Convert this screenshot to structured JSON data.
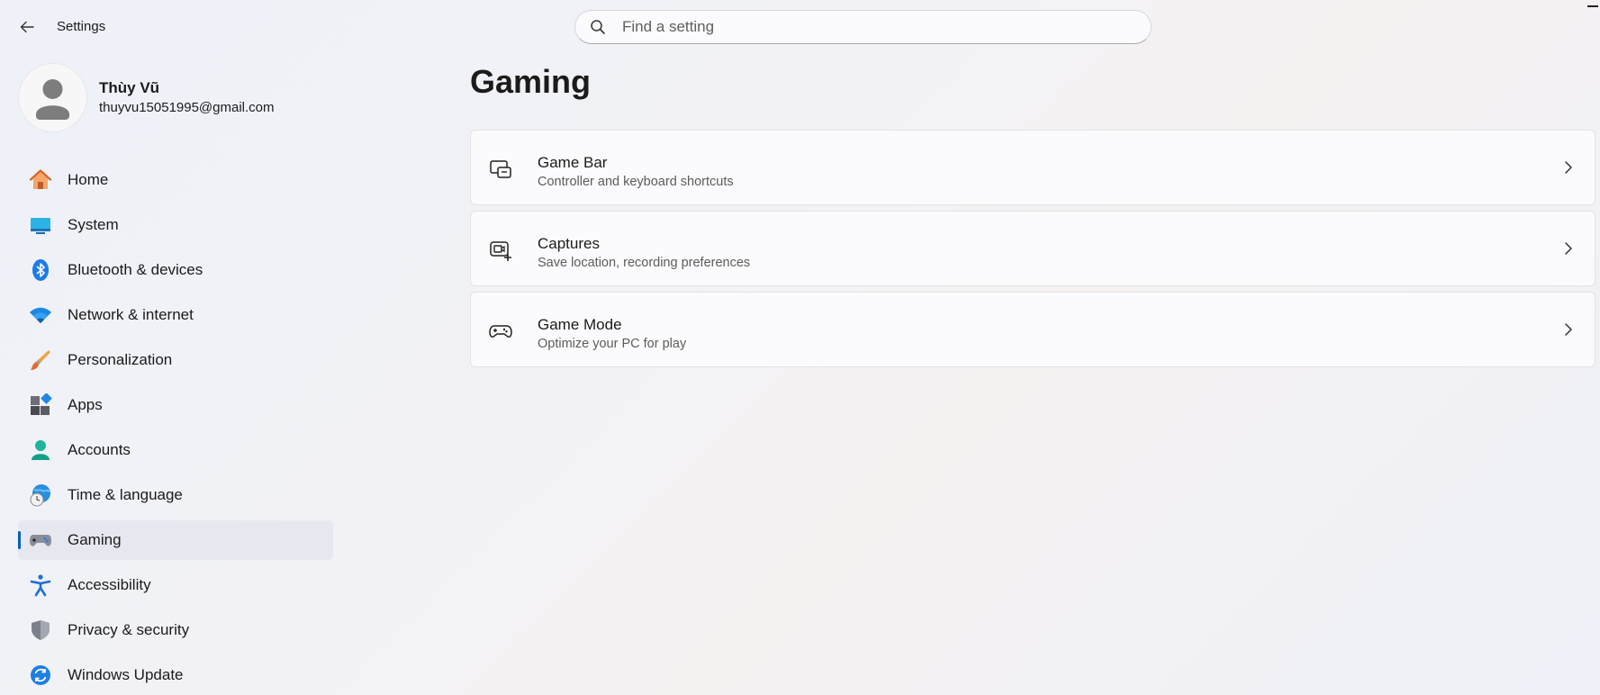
{
  "window": {
    "title": "Settings",
    "back_icon": "back-arrow-icon",
    "minimize_icon": "minimize-icon"
  },
  "search": {
    "placeholder": "Find a setting",
    "value": "",
    "icon": "search-icon"
  },
  "profile": {
    "name": "Thùy Vũ",
    "email": "thuyvu15051995@gmail.com",
    "avatar_icon": "user-avatar-icon"
  },
  "sidebar": {
    "active": "Gaming",
    "accent_color": "#005fb8",
    "items": [
      {
        "label": "Home",
        "icon": "home-icon"
      },
      {
        "label": "System",
        "icon": "monitor-icon"
      },
      {
        "label": "Bluetooth & devices",
        "icon": "bluetooth-icon"
      },
      {
        "label": "Network & internet",
        "icon": "wifi-icon"
      },
      {
        "label": "Personalization",
        "icon": "paintbrush-icon"
      },
      {
        "label": "Apps",
        "icon": "apps-icon"
      },
      {
        "label": "Accounts",
        "icon": "person-icon"
      },
      {
        "label": "Time & language",
        "icon": "globe-clock-icon"
      },
      {
        "label": "Gaming",
        "icon": "gamepad-icon"
      },
      {
        "label": "Accessibility",
        "icon": "accessibility-icon"
      },
      {
        "label": "Privacy & security",
        "icon": "shield-icon"
      },
      {
        "label": "Windows Update",
        "icon": "update-icon"
      }
    ]
  },
  "main": {
    "title": "Gaming",
    "cards": [
      {
        "title": "Game Bar",
        "subtitle": "Controller and keyboard shortcuts",
        "icon": "game-bar-icon"
      },
      {
        "title": "Captures",
        "subtitle": "Save location, recording preferences",
        "icon": "capture-icon"
      },
      {
        "title": "Game Mode",
        "subtitle": "Optimize your PC for play",
        "icon": "game-controller-icon"
      }
    ]
  }
}
